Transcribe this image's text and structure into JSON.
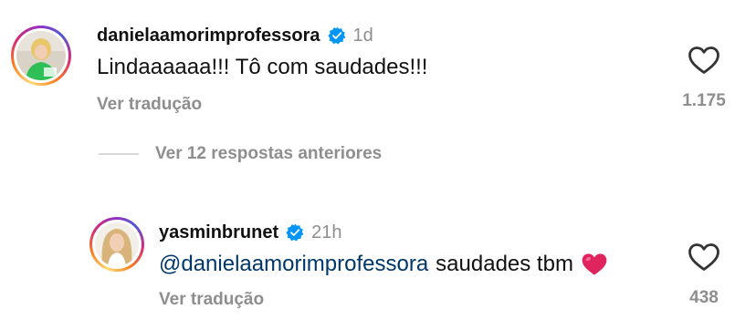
{
  "comments": [
    {
      "username": "danielaamorimprofessora",
      "time": "1d",
      "text": "Lindaaaaaa!!! Tô com saudades!!!",
      "translate": "Ver tradução",
      "likes": "1.175"
    },
    {
      "username": "yasminbrunet",
      "time": "21h",
      "mention": "@danielaamorimprofessora",
      "text": "saudades tbm",
      "emoji": "❤️",
      "translate": "Ver tradução",
      "likes": "438"
    }
  ],
  "replies_toggle": "Ver 12 respostas anteriores",
  "colors": {
    "verified": "#0095f6",
    "secondary_text": "#8e8e8e",
    "mention": "#00376b",
    "heart_emoji": "#e0245e"
  },
  "icons": {
    "verified": "verified-badge-icon",
    "like": "heart-outline-icon"
  }
}
